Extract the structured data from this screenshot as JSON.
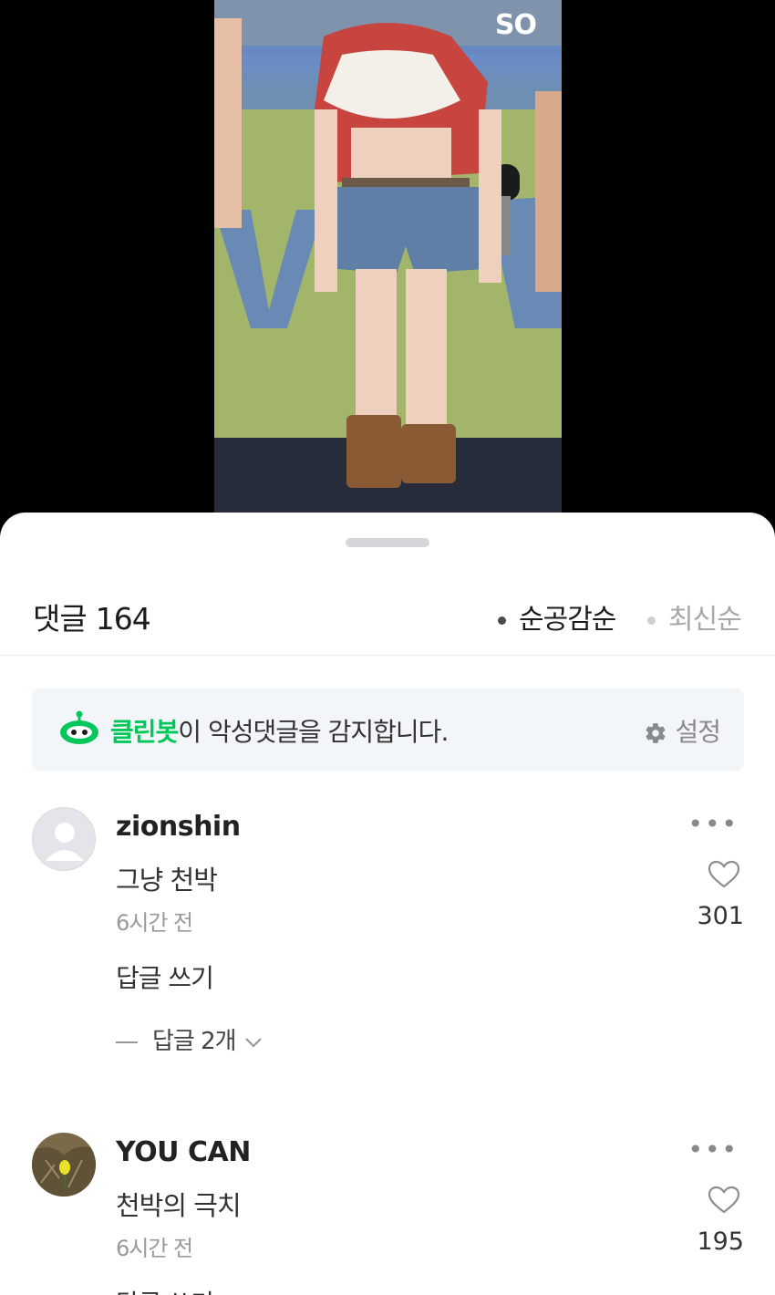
{
  "video": {
    "watermark": "SO"
  },
  "header": {
    "title": "댓글",
    "count": "164",
    "sort_options": [
      {
        "label": "순공감순",
        "active": true
      },
      {
        "label": "최신순",
        "active": false
      }
    ]
  },
  "cleanbot": {
    "brand": "클린봇",
    "message": "이 악성댓글을 감지합니다.",
    "settings_label": "설정",
    "brand_color": "#03c75a"
  },
  "comments": [
    {
      "author": "zionshin",
      "text": "그냥 천박",
      "time": "6시간 전",
      "likes": "301",
      "reply_label": "답글 쓰기",
      "replies_label": "답글 2개",
      "avatar": "default-avatar-icon"
    },
    {
      "author": "YOU CAN",
      "text": "천박의 극치",
      "time": "6시간 전",
      "likes": "195",
      "reply_label": "답글 쓰기",
      "avatar": "photo-avatar"
    }
  ]
}
